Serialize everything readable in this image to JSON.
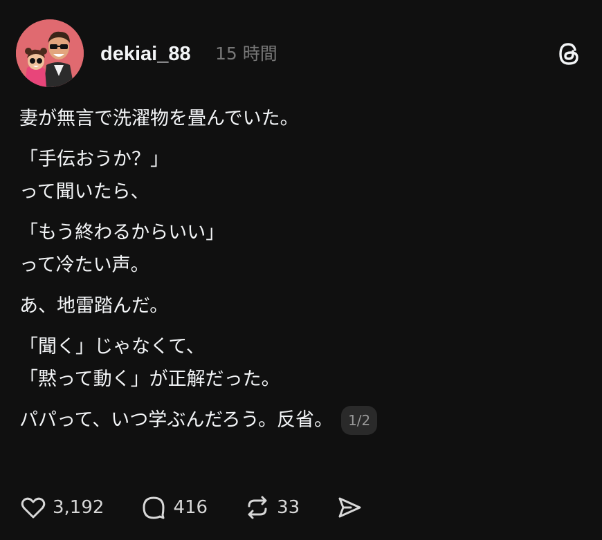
{
  "post": {
    "username": "dekiai_88",
    "timestamp": "15 時間",
    "paragraphs": [
      [
        "妻が無言で洗濯物を畳んでいた。"
      ],
      [
        "「手伝おうか？」",
        "って聞いたら、"
      ],
      [
        "「もう終わるからいい」",
        "って冷たい声。"
      ],
      [
        "あ、地雷踏んだ。"
      ],
      [
        "「聞く」じゃなくて、",
        "「黙って動く」が正解だった。"
      ]
    ],
    "last_line": "パパって、いつ学ぶんだろう。反省。",
    "page_indicator": "1/2"
  },
  "actions": {
    "likes": "3,192",
    "replies": "416",
    "reposts": "33"
  },
  "icons": {
    "avatar": "avatar-illustration",
    "threads": "threads-logo-icon",
    "like": "heart-icon",
    "reply": "comment-icon",
    "repost": "repost-icon",
    "share": "send-icon"
  },
  "colors": {
    "background": "#101010",
    "text": "#f3f5f7",
    "muted": "#777777",
    "avatar_bg": "#e06a70"
  }
}
